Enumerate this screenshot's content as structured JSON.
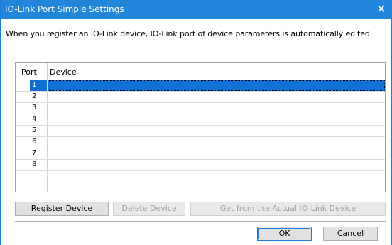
{
  "window": {
    "title": "IO-Link Port Simple Settings",
    "close_glyph": "✕"
  },
  "description": "When you register an IO-Link device, IO-Link port of device parameters is automatically edited.",
  "table": {
    "columns": {
      "port": "Port",
      "device": "Device"
    },
    "rows": [
      {
        "port": "1",
        "device": ""
      },
      {
        "port": "2",
        "device": ""
      },
      {
        "port": "3",
        "device": ""
      },
      {
        "port": "4",
        "device": ""
      },
      {
        "port": "5",
        "device": ""
      },
      {
        "port": "6",
        "device": ""
      },
      {
        "port": "7",
        "device": ""
      },
      {
        "port": "8",
        "device": ""
      }
    ],
    "selected_row": "1"
  },
  "buttons": {
    "register": "Register Device",
    "delete": "Delete Device",
    "get_actual": "Get from the Actual IO-Link Device",
    "ok": "OK",
    "cancel": "Cancel"
  },
  "colors": {
    "titlebar": "#1f86d9",
    "selection": "#1170d3"
  }
}
